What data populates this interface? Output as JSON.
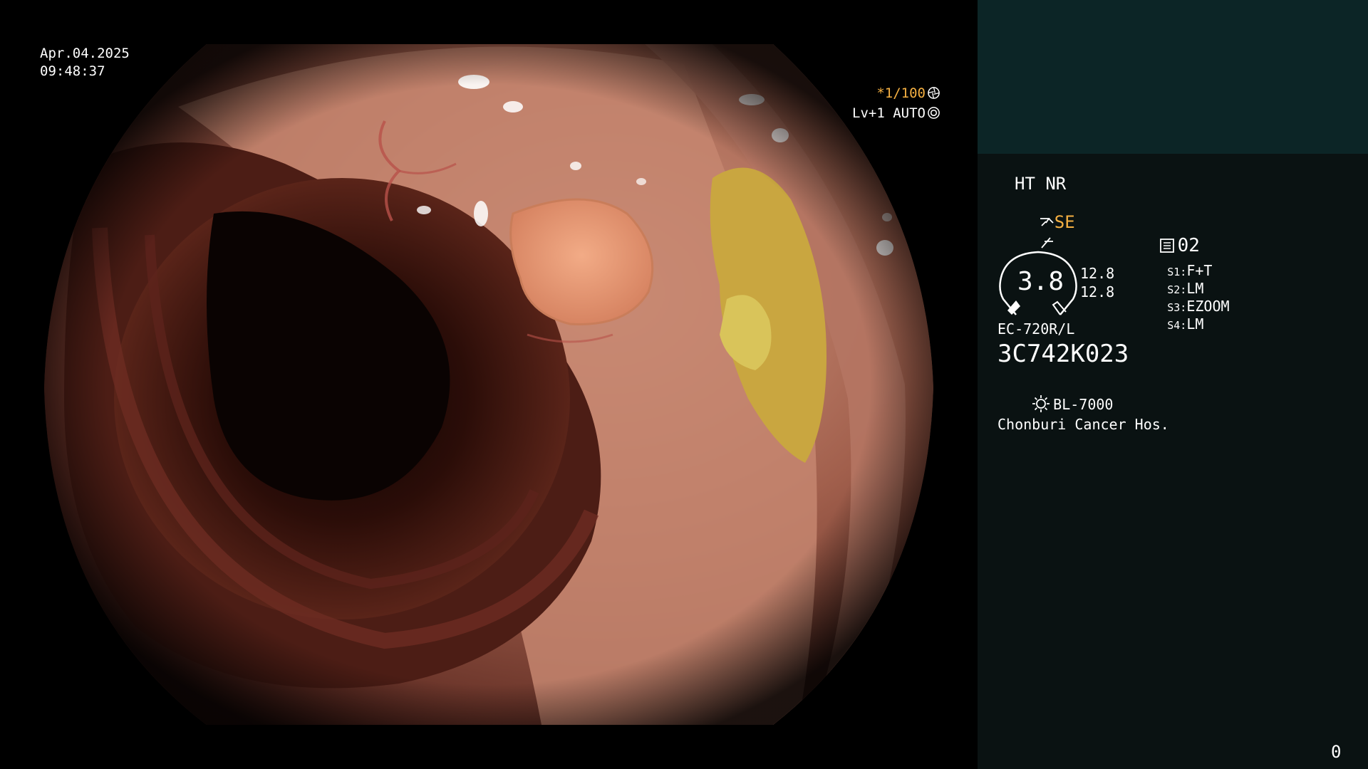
{
  "video": {
    "date": "Apr.04.2025",
    "time": "09:48:37",
    "shutter": "*1/100",
    "shutter_icon": "aperture-icon",
    "level": "Lv+1 AUTO",
    "level_icon": "iris-icon"
  },
  "panel": {
    "ht_nr": "HT NR",
    "mode_icon": "scope-mode-icon",
    "mode": "SE",
    "freeze_icon": "freeze-icon",
    "memory_icon": "memory-card-icon",
    "memory": "02",
    "zoom_gauge": "3.8",
    "zoom_value_1": "12.8",
    "zoom_value_2": "12.8",
    "switches": [
      {
        "label": "S1:",
        "value": "F+T"
      },
      {
        "label": "S2:",
        "value": "LM"
      },
      {
        "label": "S3:",
        "value": "EZOOM"
      },
      {
        "label": "S4:",
        "value": "LM"
      }
    ],
    "scope_model": "EC-720R/L",
    "serial": "3C742K023",
    "light_icon": "light-source-icon",
    "light_source": "BL-7000",
    "hospital": "Chonburi Cancer Hos.",
    "counter": "0"
  },
  "colors": {
    "accent_orange": "#f5b042",
    "panel_bg": "#0a1212",
    "panel_top_bg": "#0c2526"
  }
}
